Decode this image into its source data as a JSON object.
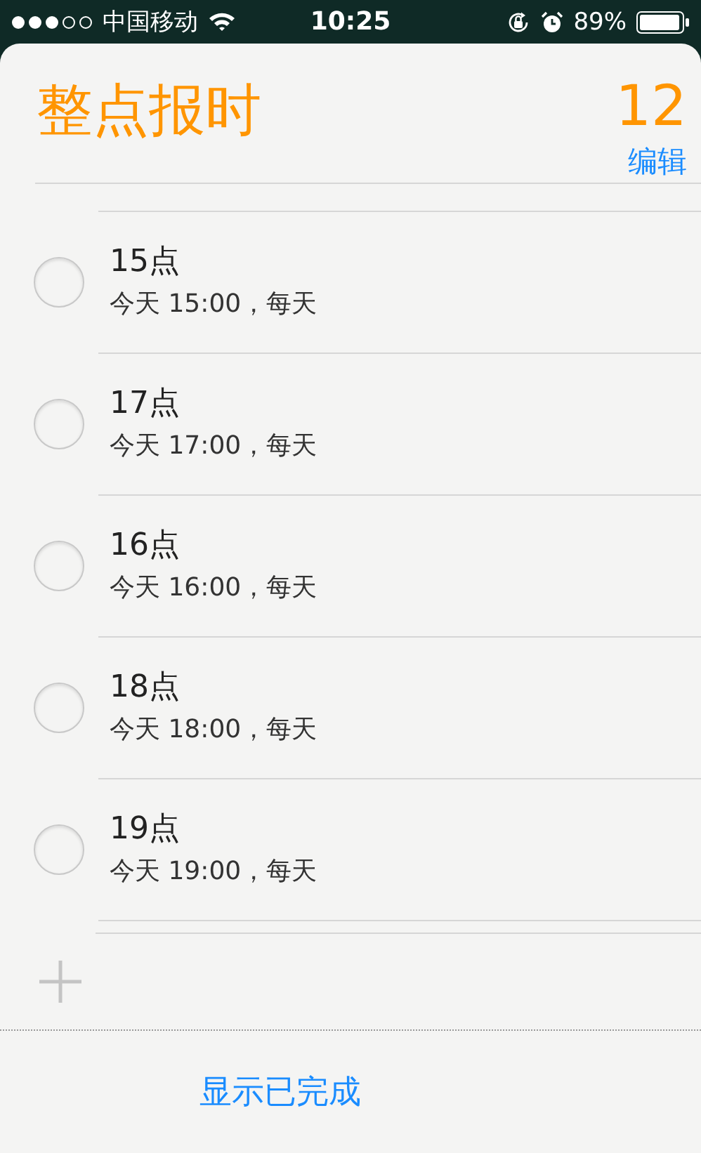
{
  "status_bar": {
    "carrier": "中国移动",
    "time": "10:25",
    "battery": "89%"
  },
  "list": {
    "title": "整点报时",
    "count": "12",
    "edit": "编辑"
  },
  "reminders": [
    {
      "title": "15点",
      "detail": "今天 15:00，每天",
      "checked": false
    },
    {
      "title": "17点",
      "detail": "今天 17:00，每天",
      "checked": false
    },
    {
      "title": "16点",
      "detail": "今天 16:00，每天",
      "checked": false
    },
    {
      "title": "18点",
      "detail": "今天 18:00，每天",
      "checked": false
    },
    {
      "title": "19点",
      "detail": "今天 19:00，每天",
      "checked": false
    }
  ],
  "footer": {
    "show_completed": "显示已完成"
  }
}
